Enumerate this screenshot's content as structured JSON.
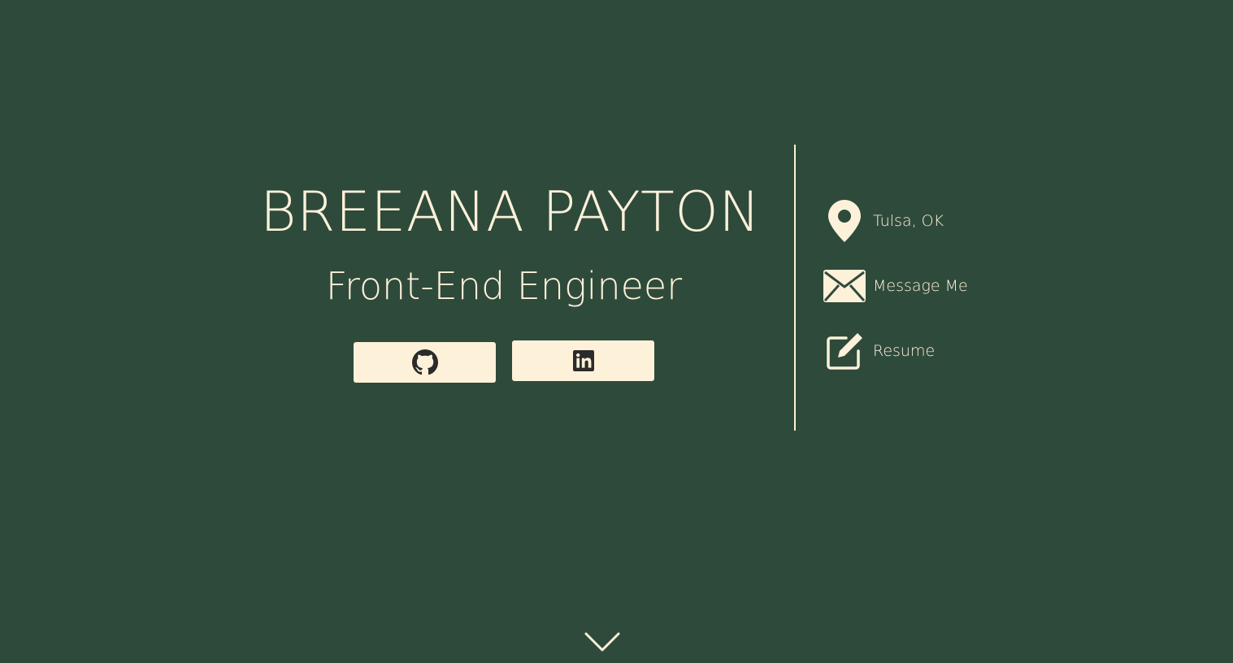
{
  "hero": {
    "name": "BREEANA PAYTON",
    "role": "Front-End Engineer"
  },
  "social": {
    "github_icon": "github-icon",
    "linkedin_icon": "linkedin-icon"
  },
  "contact": {
    "location": {
      "icon": "map-pin-icon",
      "label": "Tulsa, OK"
    },
    "message": {
      "icon": "envelope-icon",
      "label": "Message Me"
    },
    "resume": {
      "icon": "edit-icon",
      "label": "Resume"
    }
  },
  "scroll": {
    "icon": "chevron-down-icon"
  },
  "colors": {
    "background": "#2e4a3b",
    "cream": "#fdf1da",
    "dark_icon": "#2b2b2b"
  }
}
